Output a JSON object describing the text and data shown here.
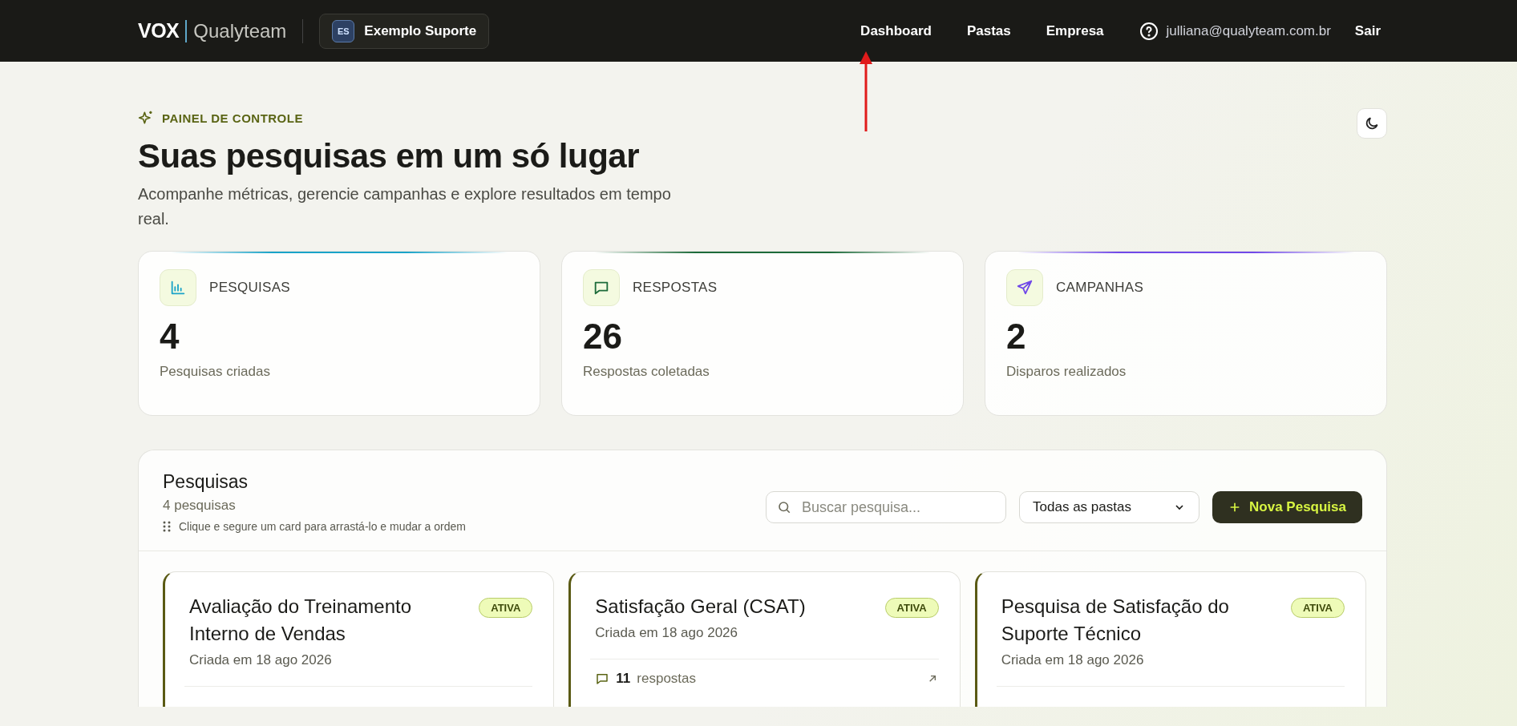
{
  "header": {
    "logo": "VOX",
    "brand": "Qualyteam",
    "workspace": {
      "initials": "ES",
      "name": "Exemplo Suporte"
    },
    "nav": [
      {
        "label": "Dashboard"
      },
      {
        "label": "Pastas"
      },
      {
        "label": "Empresa"
      }
    ],
    "user_email": "julliana@qualyteam.com.br",
    "logout": "Sair"
  },
  "intro": {
    "eyebrow": "PAINEL DE CONTROLE",
    "title": "Suas pesquisas em um só lugar",
    "subtitle": "Acompanhe métricas, gerencie campanhas e explore resultados em tempo real."
  },
  "stats": [
    {
      "kind": "chart",
      "label": "PESQUISAS",
      "value": "4",
      "caption": "Pesquisas criadas",
      "color": "#1aa3c8"
    },
    {
      "kind": "chat",
      "label": "RESPOSTAS",
      "value": "26",
      "caption": "Respostas coletadas",
      "color": "#1d6b3a"
    },
    {
      "kind": "send",
      "label": "CAMPANHAS",
      "value": "2",
      "caption": "Disparos realizados",
      "color": "#7048e8"
    }
  ],
  "surveys": {
    "title": "Pesquisas",
    "count": "4 pesquisas",
    "hint": "Clique e segure um card para arrastá-lo e mudar a ordem",
    "search": {
      "placeholder": "Buscar pesquisa..."
    },
    "folder_filter": "Todas as pastas",
    "new_button": "Nova Pesquisa",
    "cards": [
      {
        "title": "Avaliação do Treinamento Interno de Vendas",
        "created": "Criada em 18 ago 2026",
        "status": "ATIVA"
      },
      {
        "title": "Satisfação Geral (CSAT)",
        "created": "Criada em 18 ago 2026",
        "status": "ATIVA",
        "responses": {
          "count": "11",
          "label": "respostas"
        }
      },
      {
        "title": "Pesquisa de Satisfação do Suporte Técnico",
        "created": "Criada em 18 ago 2026",
        "status": "ATIVA"
      }
    ]
  }
}
